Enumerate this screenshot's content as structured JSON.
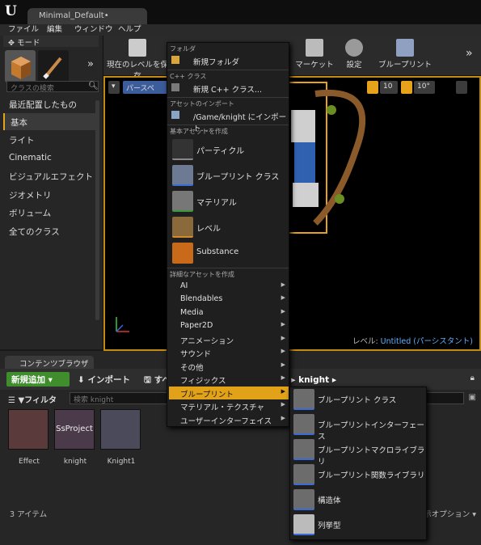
{
  "window": {
    "tab_title": "Minimal_Default•"
  },
  "menubar": [
    "ファイル",
    "編集",
    "ウィンドウ",
    "ヘルプ"
  ],
  "modes": {
    "tab_label": "モード",
    "search_placeholder": "クラスの検索",
    "categories": [
      "最近配置したもの",
      "基本",
      "ライト",
      "Cinematic",
      "ビジュアルエフェクト",
      "ジオメトリ",
      "ボリューム",
      "全てのクラス"
    ],
    "active_category": "基本"
  },
  "toolbar": {
    "save_label": "現在のレベルを保存",
    "marketplace_label": "マーケット",
    "settings_label": "設定",
    "blueprints_label": "ブループリント"
  },
  "viewport": {
    "perspective_label": "パースペ",
    "grid_snap": "10",
    "rot_snap": "10°",
    "level_prefix": "レベル:",
    "level_name": "Untitled (パーシスタント)"
  },
  "context_menu": {
    "folder_section": "フォルダ",
    "new_folder": "新規フォルダ",
    "cpp_section": "C++ クラス",
    "new_cpp": "新規 C++ クラス...",
    "import_section": "アセットのインポート",
    "import_to": "/Game/knight にインポート...",
    "basic_section": "基本アセットを作成",
    "basic_assets": [
      "パーティクル",
      "ブループリント クラス",
      "マテリアル",
      "レベル",
      "Substance"
    ],
    "advanced_section": "詳細なアセットを作成",
    "advanced_items": [
      "AI",
      "Blendables",
      "Media",
      "Paper2D",
      "アニメーション",
      "サウンド",
      "その他",
      "フィジックス",
      "ブループリント",
      "マテリアル・テクスチャ",
      "ユーザーインターフェイス"
    ],
    "highlighted": "ブループリント"
  },
  "submenu": {
    "items": [
      "ブループリント クラス",
      "ブループリントインターフェース",
      "ブループリントマクロライブラリ",
      "ブループリント関数ライブラリ",
      "構造体",
      "列挙型"
    ]
  },
  "content_browser": {
    "tab_label": "コンテンツブラウザ",
    "add_new_label": "新規追加",
    "import_label": "インポート",
    "save_all_label": "すべ",
    "path_tail": "ツ",
    "path_folder": "knight",
    "filter_label": "フィルタ",
    "search_placeholder": "検索 knight",
    "assets": [
      "Effect",
      "knight",
      "Knight1"
    ],
    "asset_thumb_text": "SsProject",
    "item_count": "3 アイテム",
    "view_options": "表示オプション"
  },
  "colors": {
    "accent": "#e1a21a",
    "add_new_green": "#3f8d2c",
    "link_blue": "#5fb0ff"
  }
}
